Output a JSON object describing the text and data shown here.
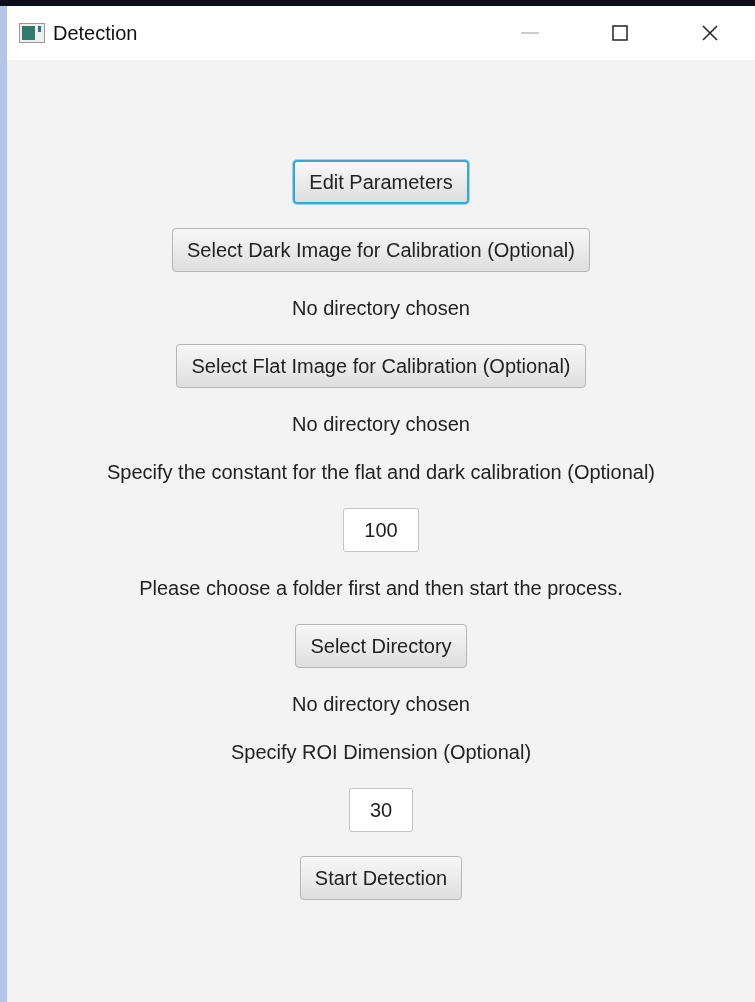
{
  "window": {
    "title": "Detection"
  },
  "items": [
    {
      "kind": "button",
      "label": "Edit Parameters",
      "focused": true
    },
    {
      "kind": "button",
      "label": "Select Dark Image for Calibration (Optional)",
      "focused": false
    },
    {
      "kind": "label",
      "text": "No directory chosen"
    },
    {
      "kind": "button",
      "label": "Select Flat Image for Calibration (Optional)",
      "focused": false
    },
    {
      "kind": "label",
      "text": "No directory chosen"
    },
    {
      "kind": "label",
      "text": "Specify the constant for the flat and dark calibration (Optional)"
    },
    {
      "kind": "field",
      "value": "100"
    },
    {
      "kind": "label",
      "text": "Please choose a folder first and then start the process."
    },
    {
      "kind": "button",
      "label": "Select Directory",
      "focused": false
    },
    {
      "kind": "label",
      "text": "No directory chosen"
    },
    {
      "kind": "label",
      "text": "Specify ROI Dimension (Optional)"
    },
    {
      "kind": "field",
      "value": "30"
    },
    {
      "kind": "button",
      "label": "Start Detection",
      "focused": false
    }
  ]
}
